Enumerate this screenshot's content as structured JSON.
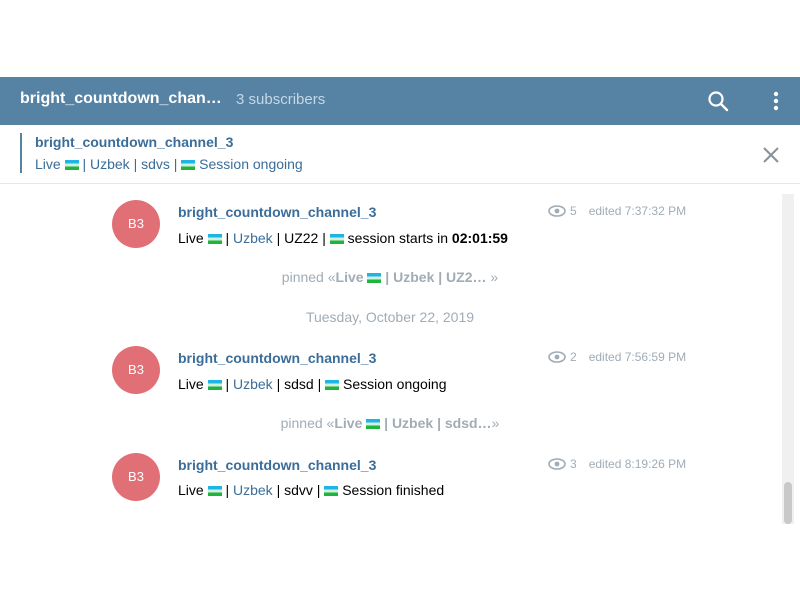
{
  "header": {
    "title": "bright_countdown_chan…",
    "subscribers": "3 subscribers",
    "search_icon": "search-icon",
    "menu_icon": "more-vertical-icon"
  },
  "pinned_bar": {
    "title": "bright_countdown_channel_3",
    "text_parts": [
      "Live ",
      " | Uzbek | sdvs | ",
      " Session ongoing"
    ],
    "close_icon": "close-icon"
  },
  "messages": [
    {
      "avatar": "B3",
      "author": "bright_countdown_channel_3",
      "views": "5",
      "edited": "edited 7:37:32 PM",
      "body_a": "Live ",
      "body_b": " | ",
      "body_link": "Uzbek",
      "body_c": " | UZ22 | ",
      "body_d": " session starts in ",
      "body_bold": "02:01:59"
    },
    {
      "avatar": "B3",
      "author": "bright_countdown_channel_3",
      "views": "2",
      "edited": "edited 7:56:59 PM",
      "body_a": "Live ",
      "body_b": " | ",
      "body_link": "Uzbek",
      "body_c": " | sdsd | ",
      "body_d": " Session ongoing"
    },
    {
      "avatar": "B3",
      "author": "bright_countdown_channel_3",
      "views": "3",
      "edited": "edited 8:19:26 PM",
      "body_a": "Live ",
      "body_b": " | ",
      "body_link": "Uzbek",
      "body_c": " | sdvv | ",
      "body_d": " Session finished"
    }
  ],
  "service_messages": [
    {
      "prefix": "pinned «",
      "bold_a": "Live ",
      "bold_b": " | Uzbek | UZ2…",
      "suffix": " »"
    },
    {
      "date": "Tuesday, October 22, 2019"
    },
    {
      "prefix": "pinned «",
      "bold_a": "Live ",
      "bold_b": " | Uzbek | sdsd…",
      "suffix": "»"
    }
  ],
  "colors": {
    "header": "#5682a3",
    "link": "#3a6d99",
    "avatar": "#e17076",
    "meta": "#a0acb6"
  }
}
